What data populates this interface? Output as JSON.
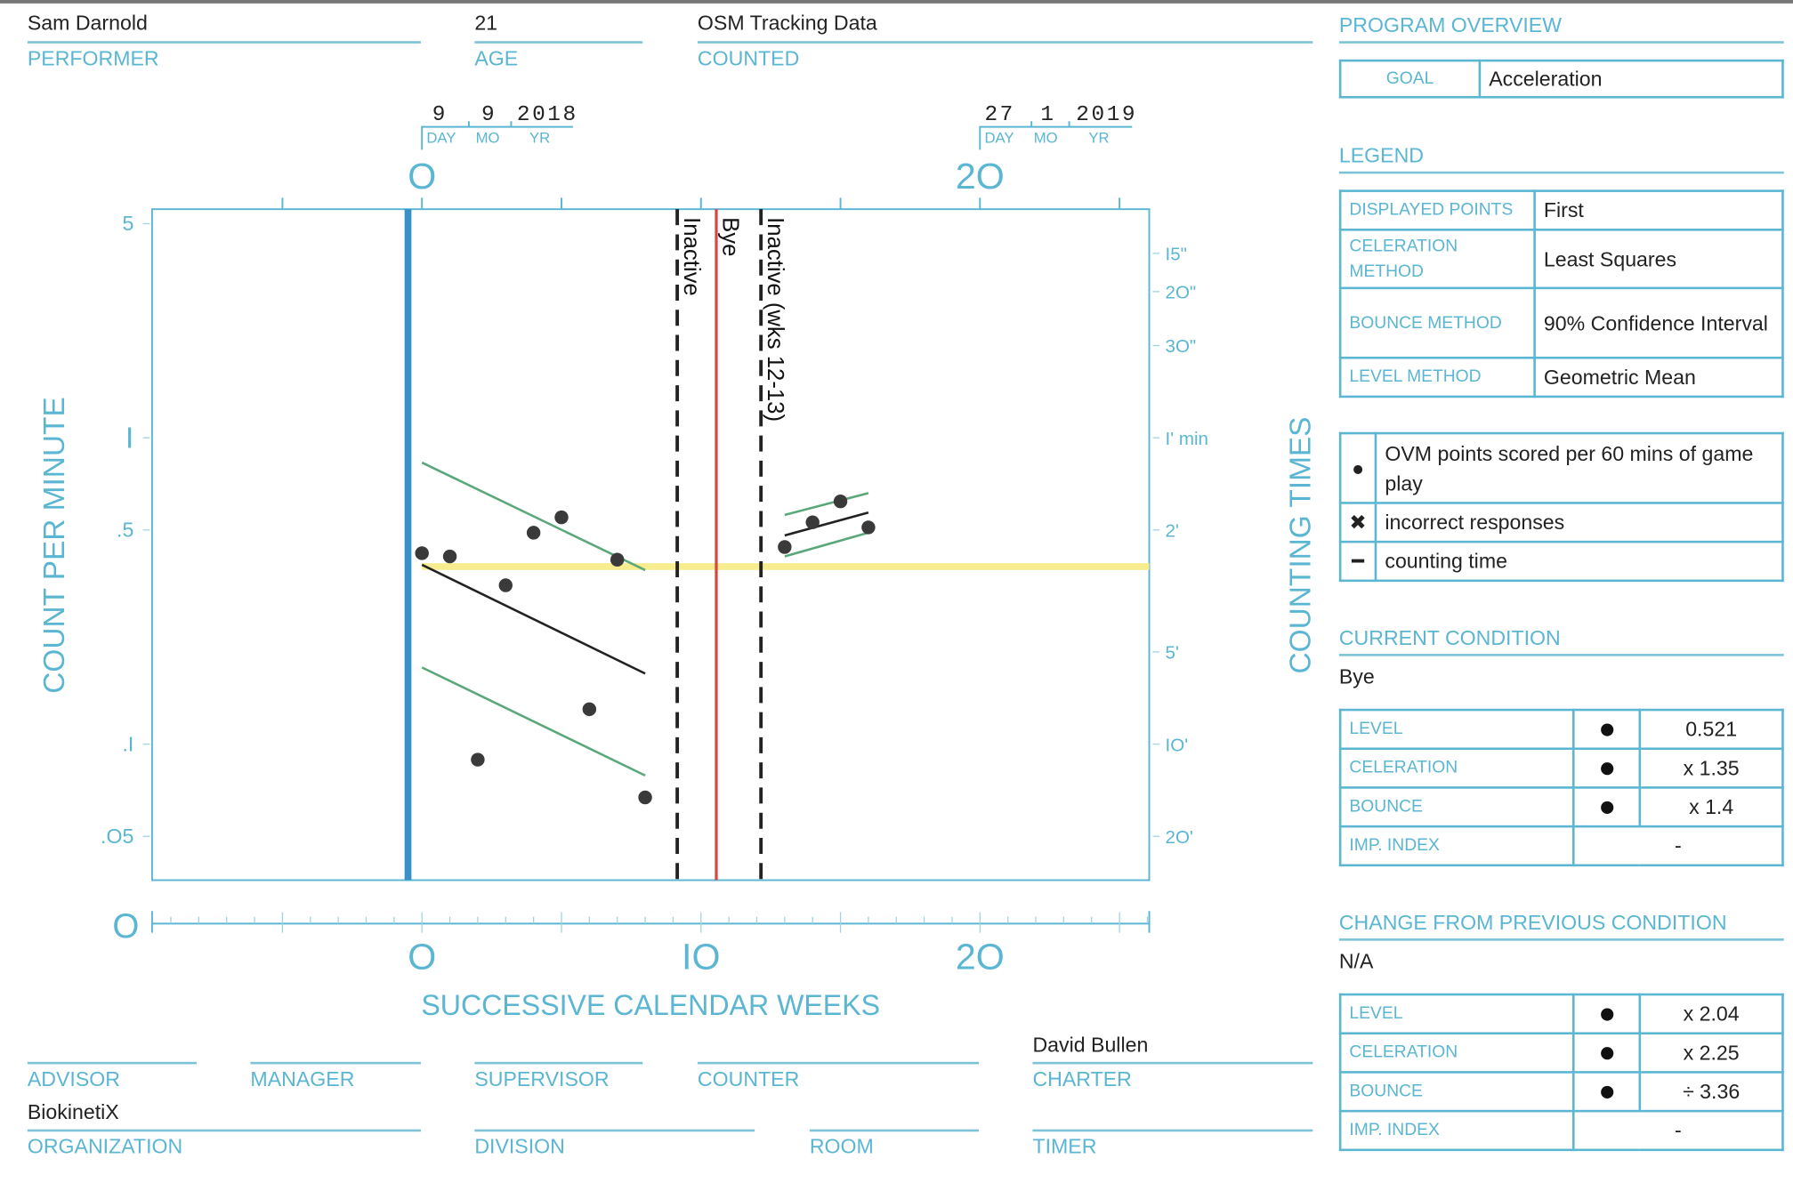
{
  "header": {
    "performer": {
      "value": "Sam Darnold",
      "label": "PERFORMER"
    },
    "age": {
      "value": "21",
      "label": "AGE"
    },
    "counted": {
      "value": "OSM Tracking Data",
      "label": "COUNTED"
    }
  },
  "dates": {
    "start": {
      "day": "9",
      "month": "9",
      "year": "2018"
    },
    "end": {
      "day": "27",
      "month": "1",
      "year": "2019"
    },
    "day_label": "DAY",
    "month_label": "MO",
    "year_label": "YR"
  },
  "program_overview": {
    "title": "PROGRAM OVERVIEW",
    "goal_label": "GOAL",
    "goal_value": "Acceleration"
  },
  "legend": {
    "title": "LEGEND",
    "rows": [
      {
        "label": "DISPLAYED POINTS",
        "value": "First"
      },
      {
        "label": "CELERATION METHOD",
        "value": "Least Squares"
      },
      {
        "label": "BOUNCE METHOD",
        "value": "90% Confidence Interval"
      },
      {
        "label": "LEVEL METHOD",
        "value": "Geometric Mean"
      }
    ],
    "symbols": [
      {
        "icon": "filled-dot-icon",
        "glyph": "●",
        "text": "OVM points scored per 60 mins of game play"
      },
      {
        "icon": "x-mark-icon",
        "glyph": "✖",
        "text": "incorrect responses"
      },
      {
        "icon": "dash-icon",
        "glyph": "━",
        "text": "counting time"
      }
    ]
  },
  "current_condition": {
    "title": "CURRENT CONDITION",
    "name": "Bye",
    "rows": [
      {
        "label": "LEVEL",
        "value": "0.521"
      },
      {
        "label": "CELERATION",
        "value": "x 1.35"
      },
      {
        "label": "BOUNCE",
        "value": "x 1.4"
      },
      {
        "label": "IMP. INDEX",
        "value": "-"
      }
    ]
  },
  "change_condition": {
    "title": "CHANGE FROM PREVIOUS CONDITION",
    "name": "N/A",
    "rows": [
      {
        "label": "LEVEL",
        "value": "x 2.04"
      },
      {
        "label": "CELERATION",
        "value": "x 2.25"
      },
      {
        "label": "BOUNCE",
        "value": "÷ 3.36"
      },
      {
        "label": "IMP. INDEX",
        "value": "-"
      }
    ]
  },
  "footer": {
    "advisor": {
      "label": "ADVISOR",
      "value": ""
    },
    "manager": {
      "label": "MANAGER",
      "value": ""
    },
    "supervisor": {
      "label": "SUPERVISOR",
      "value": ""
    },
    "counter": {
      "label": "COUNTER",
      "value": ""
    },
    "charter": {
      "label": "CHARTER",
      "value": "David Bullen"
    },
    "organization": {
      "label": "ORGANIZATION",
      "value": "BiokinetiX"
    },
    "division": {
      "label": "DIVISION",
      "value": ""
    },
    "room": {
      "label": "ROOM",
      "value": ""
    },
    "timer": {
      "label": "TIMER",
      "value": ""
    }
  },
  "colors": {
    "accent": "#5ab6d2",
    "start_line": "#3a8fc7",
    "phase_red": "#d9443f",
    "celeration_green": "#5aa87a",
    "level_yellow": "#f7ec8e",
    "points": "#3a3a3a"
  },
  "chart_data": {
    "type": "scatter",
    "y_scale": "log",
    "xlabel": "SUCCESSIVE CALENDAR WEEKS",
    "ylabel": "COUNT PER MINUTE",
    "y2label": "COUNTING TIMES",
    "xlim": [
      -9.7,
      26.1
    ],
    "ylim": [
      0.036,
      5.6
    ],
    "x_ticks_bottom": [
      {
        "x": 0,
        "label": "O"
      },
      {
        "x": 10,
        "label": "IO"
      },
      {
        "x": 20,
        "label": "2O"
      }
    ],
    "x_ticks_top": [
      {
        "x": 0,
        "label": "O"
      },
      {
        "x": 20,
        "label": "2O"
      }
    ],
    "bottom_axis_zero_label": "O",
    "y_ticks": [
      {
        "y": 5,
        "label": "5"
      },
      {
        "y": 1,
        "label": "I"
      },
      {
        "y": 0.5,
        "label": ".5"
      },
      {
        "y": 0.1,
        "label": ".I"
      },
      {
        "y": 0.05,
        "label": ".O5"
      }
    ],
    "y2_ticks": [
      {
        "y": 4,
        "label": "I5\""
      },
      {
        "y": 3,
        "label": "2O\""
      },
      {
        "y": 2,
        "label": "3O\""
      },
      {
        "y": 1,
        "label": "I' min"
      },
      {
        "y": 0.5,
        "label": "2'"
      },
      {
        "y": 0.2,
        "label": "5'"
      },
      {
        "y": 0.1,
        "label": "IO'"
      },
      {
        "y": 0.05,
        "label": "2O'"
      }
    ],
    "points": [
      {
        "x": 0,
        "y": 0.42
      },
      {
        "x": 1,
        "y": 0.41
      },
      {
        "x": 2,
        "y": 0.089
      },
      {
        "x": 3,
        "y": 0.33
      },
      {
        "x": 4,
        "y": 0.49
      },
      {
        "x": 5,
        "y": 0.55
      },
      {
        "x": 6,
        "y": 0.13
      },
      {
        "x": 7,
        "y": 0.4
      },
      {
        "x": 8,
        "y": 0.067
      },
      {
        "x": 13,
        "y": 0.44
      },
      {
        "x": 14,
        "y": 0.53
      },
      {
        "x": 15,
        "y": 0.62
      },
      {
        "x": 16,
        "y": 0.51
      }
    ],
    "start_line": {
      "x": -0.5
    },
    "phase_lines": [
      {
        "x": 9.15,
        "style": "dashed",
        "label": "Inactive"
      },
      {
        "x": 10.55,
        "style": "solid-red",
        "label": "Bye"
      },
      {
        "x": 12.15,
        "style": "dashed",
        "label": "Inactive (wks 12-13)"
      }
    ],
    "level_line": {
      "x": [
        0,
        26.1
      ],
      "y": 0.38
    },
    "celeration_lines": [
      {
        "kind": "trend",
        "x": [
          0,
          8
        ],
        "y": [
          0.385,
          0.17
        ]
      },
      {
        "kind": "upper",
        "x": [
          0,
          8
        ],
        "y": [
          0.83,
          0.37
        ]
      },
      {
        "kind": "lower",
        "x": [
          0,
          8
        ],
        "y": [
          0.178,
          0.079
        ]
      },
      {
        "kind": "trend",
        "x": [
          13,
          16
        ],
        "y": [
          0.48,
          0.57
        ]
      },
      {
        "kind": "upper",
        "x": [
          13,
          16
        ],
        "y": [
          0.56,
          0.66
        ]
      },
      {
        "kind": "lower",
        "x": [
          13,
          16
        ],
        "y": [
          0.41,
          0.49
        ]
      }
    ]
  }
}
